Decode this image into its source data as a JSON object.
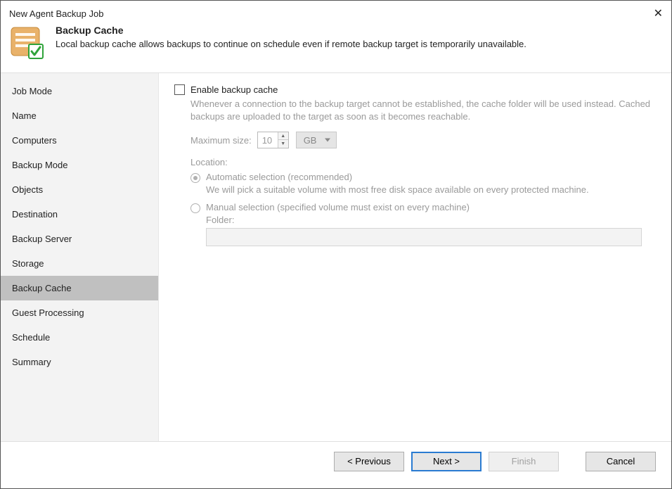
{
  "window": {
    "title": "New Agent Backup Job"
  },
  "header": {
    "title": "Backup Cache",
    "description": "Local backup cache allows backups to continue on schedule even if remote backup target is temporarily unavailable."
  },
  "sidebar": {
    "items": [
      {
        "label": "Job Mode",
        "active": false
      },
      {
        "label": "Name",
        "active": false
      },
      {
        "label": "Computers",
        "active": false
      },
      {
        "label": "Backup Mode",
        "active": false
      },
      {
        "label": "Objects",
        "active": false
      },
      {
        "label": "Destination",
        "active": false
      },
      {
        "label": "Backup Server",
        "active": false
      },
      {
        "label": "Storage",
        "active": false
      },
      {
        "label": "Backup Cache",
        "active": true
      },
      {
        "label": "Guest Processing",
        "active": false
      },
      {
        "label": "Schedule",
        "active": false
      },
      {
        "label": "Summary",
        "active": false
      }
    ]
  },
  "main": {
    "enable_label": "Enable backup cache",
    "enable_help": "Whenever a connection to the backup target cannot be established, the cache folder will be used instead. Cached backups are uploaded to the target as soon as it becomes reachable.",
    "maxsize_label": "Maximum size:",
    "maxsize_value": "10",
    "unit": "GB",
    "location_label": "Location:",
    "radio_auto_label": "Automatic selection (recommended)",
    "radio_auto_help": "We will pick a suitable volume with most free disk space available on every protected machine.",
    "radio_manual_label": "Manual selection (specified volume must exist on every machine)",
    "folder_label": "Folder:"
  },
  "footer": {
    "previous": "< Previous",
    "next": "Next >",
    "finish": "Finish",
    "cancel": "Cancel"
  }
}
